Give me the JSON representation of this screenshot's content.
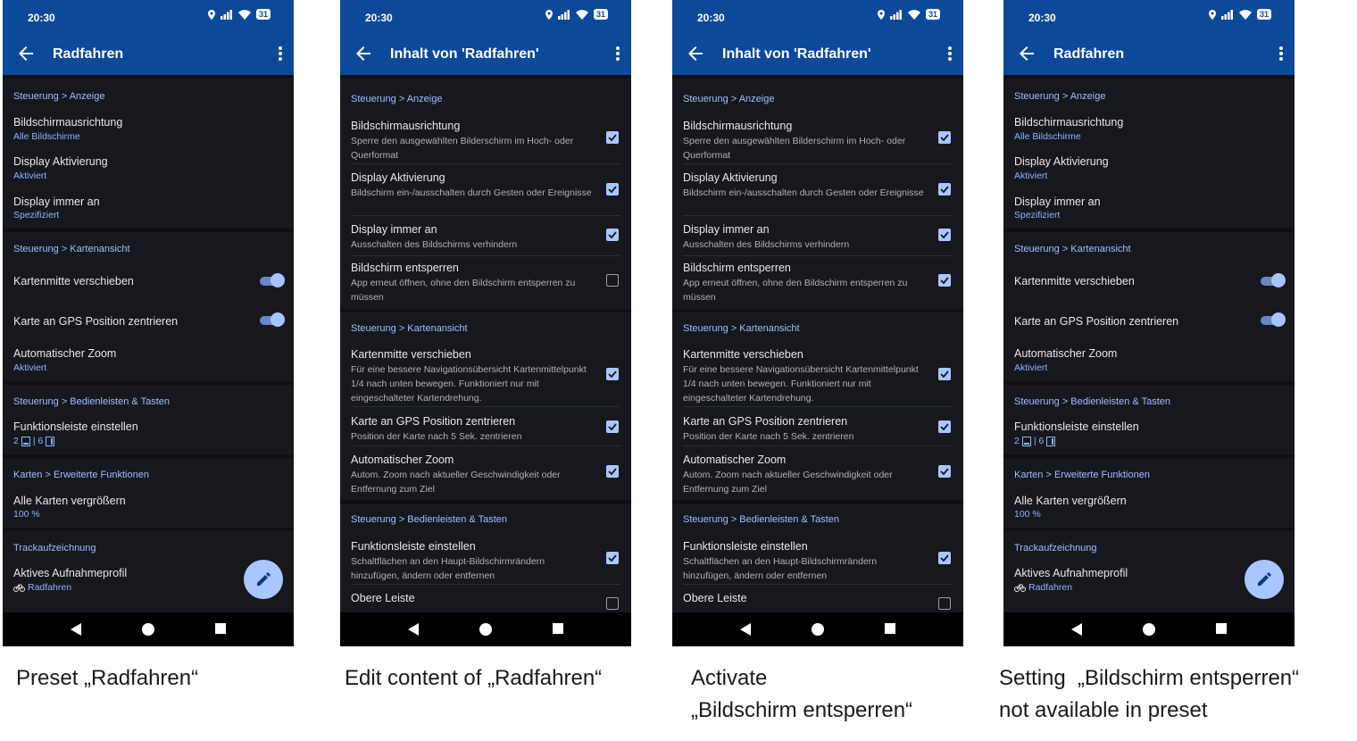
{
  "status": {
    "time": "20:30",
    "battery": "31"
  },
  "s1": {
    "title": "Radfahren",
    "sec_anzeige": "Steuerung > Anzeige",
    "orient_title": "Bildschirmausrichtung",
    "orient_value": "Alle Bildschirme",
    "disp_act_title": "Display Aktivierung",
    "disp_act_value": "Aktiviert",
    "always_on_title": "Display immer an",
    "always_on_value": "Spezifiziert",
    "sec_karte": "Steuerung > Kartenansicht",
    "map_center": "Kartenmitte verschieben",
    "gps_center": "Karte an GPS Position zentrieren",
    "auto_zoom_title": "Automatischer Zoom",
    "auto_zoom_value": "Aktiviert",
    "sec_bedien": "Steuerung > Bedienleisten & Tasten",
    "toolbar_title": "Funktionsleiste einstellen",
    "toolbar_a": "2",
    "toolbar_b": "| 6",
    "sec_karten_ext": "Karten > Erweiterte Funktionen",
    "maps_enlarge_title": "Alle Karten vergrößern",
    "maps_enlarge_value": "100 %",
    "sec_track": "Trackaufzeichnung",
    "profile_title": "Aktives Aufnahmeprofil",
    "profile_value": "Radfahren"
  },
  "s2": {
    "title": "Inhalt von 'Radfahren'",
    "sec_anzeige": "Steuerung > Anzeige",
    "orient_title": "Bildschirmausrichtung",
    "orient_desc": "Sperre den ausgewählten Bilderschirm im Hoch- oder Querformat",
    "disp_act_title": "Display Aktivierung",
    "disp_act_desc": "Bildschirm ein-/ausschalten durch Gesten oder Ereignisse",
    "always_on_title": "Display immer an",
    "always_on_desc": "Ausschalten des Bildschirms verhindern",
    "unlock_title": "Bildschirm entsperren",
    "unlock_desc": "App erneut öffnen, ohne den Bildschirm entsperren zu müssen",
    "sec_karte": "Steuerung > Kartenansicht",
    "map_center_title": "Kartenmitte verschieben",
    "map_center_desc": "Für eine bessere Navigationsübersicht Kartenmittelpunkt 1/4 nach unten bewegen. Funktioniert nur mit eingeschalteter Kartendrehung.",
    "gps_title": "Karte an GPS Position zentrieren",
    "gps_desc": "Position der Karte nach 5 Sek. zentrieren",
    "zoom_title": "Automatischer Zoom",
    "zoom_desc": "Autom. Zoom nach aktueller Geschwindigkeit oder Entfernung zum Ziel",
    "sec_bedien": "Steuerung > Bedienleisten & Tasten",
    "toolbar_title": "Funktionsleiste einstellen",
    "toolbar_desc": "Schaltflächen an den Haupt-Bildschirmrändern hinzufügen, ändern oder entfernen",
    "top_bar_title": "Obere Leiste"
  },
  "s3": {
    "title": "Inhalt von 'Radfahren'"
  },
  "checkbox_state": {
    "panel2_unlock": false,
    "panel3_unlock": true,
    "top_bar": false
  },
  "captions": {
    "c1": "Preset „Radfahren“",
    "c2": "Edit content of „Radfahren“",
    "c3_l1": "Activate",
    "c3_l2": "„Bildschirm entsperren“",
    "c4_l1": "Setting  „Bildschirm entsperren“",
    "c4_l2": "not available in preset"
  },
  "colors": {
    "appbar": "#0c4a99",
    "background": "#17181d",
    "accent": "#a9c6ff"
  }
}
